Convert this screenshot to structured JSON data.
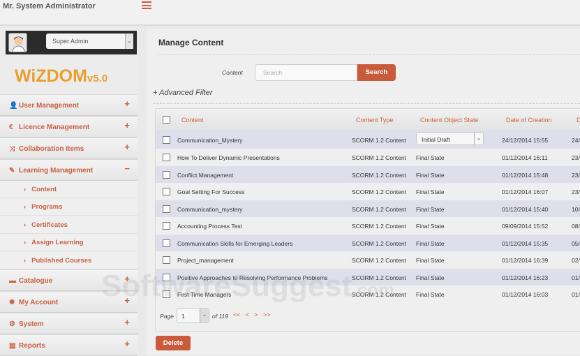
{
  "header": {
    "user": "Mr. System Administrator"
  },
  "profile": {
    "role": "Super Admin"
  },
  "logo": {
    "name": "WiZDOM",
    "version": "v5.0"
  },
  "sidebar": {
    "top": [
      {
        "label": "User Management",
        "icon": "user-icon",
        "toggle": "+"
      },
      {
        "label": "Licence Management",
        "icon": "euro-icon",
        "toggle": "+"
      },
      {
        "label": "Collaboration Items",
        "icon": "shuffle-icon",
        "toggle": "+"
      },
      {
        "label": "Learning Management",
        "icon": "edit-icon",
        "toggle": "−"
      }
    ],
    "sub": [
      {
        "label": "Content"
      },
      {
        "label": "Programs"
      },
      {
        "label": "Certificates"
      },
      {
        "label": "Assign Learning"
      },
      {
        "label": "Published Courses"
      }
    ],
    "bottom": [
      {
        "label": "Catalogue",
        "icon": "briefcase-icon",
        "toggle": "+"
      },
      {
        "label": "My Account",
        "icon": "gear-icon",
        "toggle": "+"
      },
      {
        "label": "System",
        "icon": "gears-icon",
        "toggle": "+"
      },
      {
        "label": "Reports",
        "icon": "report-icon",
        "toggle": "+"
      }
    ]
  },
  "main": {
    "title": "Manage Content",
    "filter_label": "Content",
    "search_placeholder": "Search",
    "search_button": "Search",
    "advanced_filter": "+ Advanced Filter"
  },
  "table": {
    "headers": [
      "Content",
      "Content Type",
      "Content Object State",
      "Date of Creation",
      "D"
    ],
    "rows": [
      {
        "content": "Communication_Mystery",
        "type": "SCORM 1.2 Content",
        "state": "Initial Draft",
        "created": "24/12/2014 15:55",
        "last": "24/"
      },
      {
        "content": "How To Deliver Dynamic Presentations",
        "type": "SCORM 1.2 Content",
        "state": "Final State",
        "created": "01/12/2014 16:11",
        "last": "23/"
      },
      {
        "content": "Conflict Management",
        "type": "SCORM 1.2 Content",
        "state": "Final State",
        "created": "01/12/2014 15:48",
        "last": "23/"
      },
      {
        "content": "Goal Setting For Success",
        "type": "SCORM 1.2 Content",
        "state": "Final State",
        "created": "01/12/2014 16:07",
        "last": "23/"
      },
      {
        "content": "Communication_mystery",
        "type": "SCORM 1.2 Content",
        "state": "Final State",
        "created": "01/12/2014 15:40",
        "last": "10/"
      },
      {
        "content": "Accounting Process Test",
        "type": "SCORM 1.2 Content",
        "state": "Final State",
        "created": "09/09/2014 15:52",
        "last": "08/"
      },
      {
        "content": "Communication Skills for Emerging Leaders",
        "type": "SCORM 1.2 Content",
        "state": "Final State",
        "created": "01/12/2014 15:35",
        "last": "05/"
      },
      {
        "content": "Project_management",
        "type": "SCORM 1.2 Content",
        "state": "Final State",
        "created": "01/12/2014 16:39",
        "last": "02/"
      },
      {
        "content": "Positive Approaches to Resolving Performance Problems",
        "type": "SCORM 1.2 Content",
        "state": "Final State",
        "created": "01/12/2014 16:23",
        "last": "01/"
      },
      {
        "content": "First Time Managers",
        "type": "SCORM 1.2 Content",
        "state": "Final State",
        "created": "01/12/2014 16:03",
        "last": "01/"
      }
    ]
  },
  "pagination": {
    "label": "Page",
    "current": "1",
    "of": "of 119",
    "first": "<<",
    "prev": "<",
    "next": ">",
    "last": ">>"
  },
  "actions": {
    "delete": "Delete"
  },
  "watermark": {
    "text": "SoftwareSuggest",
    ".com": ".com"
  }
}
